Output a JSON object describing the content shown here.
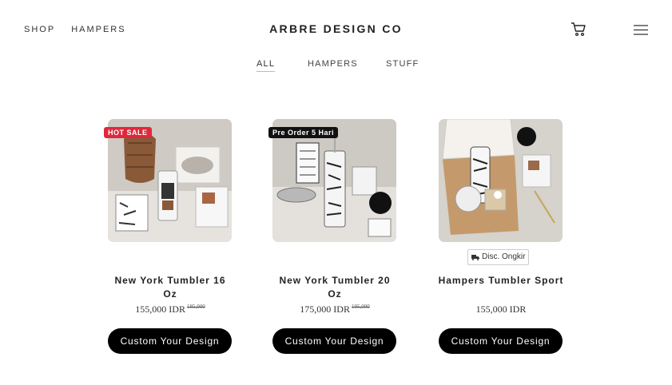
{
  "header": {
    "nav": [
      "SHOP",
      "HAMPERS"
    ],
    "brand": "ARBRE DESIGN CO",
    "cart_icon": "cart-icon",
    "menu_icon": "hamburger-menu-icon"
  },
  "filters": {
    "items": [
      "ALL",
      "HAMPERS",
      "STUFF"
    ],
    "active": "ALL"
  },
  "products": [
    {
      "badge": "HOT SALE",
      "name": "New York Tumbler 16 Oz",
      "price": "155,000 IDR",
      "old_price": "185,000",
      "cta": "Custom Your Design"
    },
    {
      "badge": "Pre Order 5 Hari",
      "name": "New York Tumbler 20 Oz",
      "price": "175,000 IDR",
      "old_price": "195,000",
      "cta": "Custom Your Design"
    },
    {
      "tag": "Disc. Ongkir",
      "name": "Hampers Tumbler Sport",
      "price": "155,000 IDR",
      "cta": "Custom Your Design"
    }
  ],
  "colors": {
    "hot_sale": "#e0283c",
    "button": "#000000"
  }
}
